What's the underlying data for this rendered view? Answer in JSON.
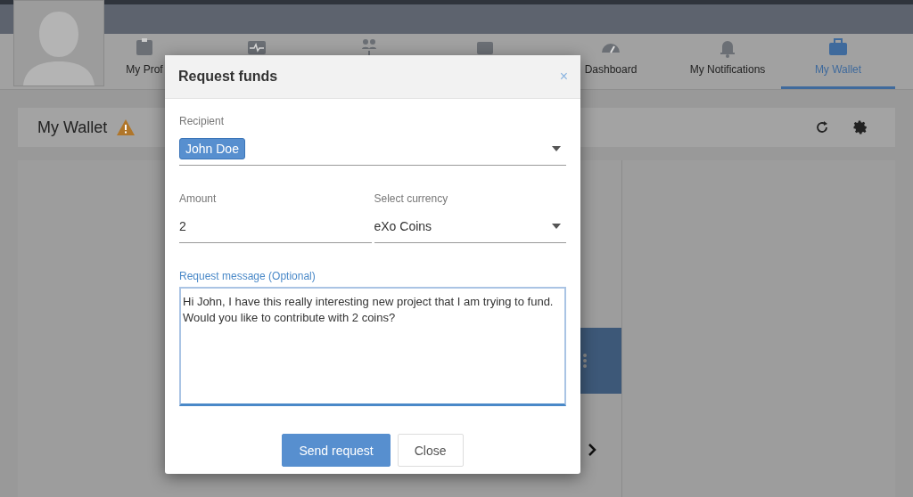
{
  "nav": {
    "tabs": [
      {
        "label": "My Prof",
        "selected": false
      },
      {
        "selected": false
      },
      {
        "selected": false
      },
      {
        "selected": false
      },
      {
        "label": "Dashboard",
        "selected": false
      },
      {
        "label": "My Notifications",
        "selected": false
      },
      {
        "label": "My Wallet",
        "selected": true
      }
    ]
  },
  "wallet": {
    "title": "My Wallet"
  },
  "modal": {
    "title": "Request funds",
    "close": "×",
    "recipient": {
      "label": "Recipient",
      "chip": "John Doe"
    },
    "amount": {
      "label": "Amount",
      "value": "2"
    },
    "currency": {
      "label": "Select currency",
      "value": "eXo Coins"
    },
    "message": {
      "label": "Request message (Optional)",
      "value": "Hi John, I have this really interesting new project that I am trying to fund. Would you like to contribute with 2 coins?"
    },
    "buttons": [
      {
        "label": "Send request",
        "kind": "primary"
      },
      {
        "label": "Close",
        "kind": "secondary"
      }
    ]
  }
}
